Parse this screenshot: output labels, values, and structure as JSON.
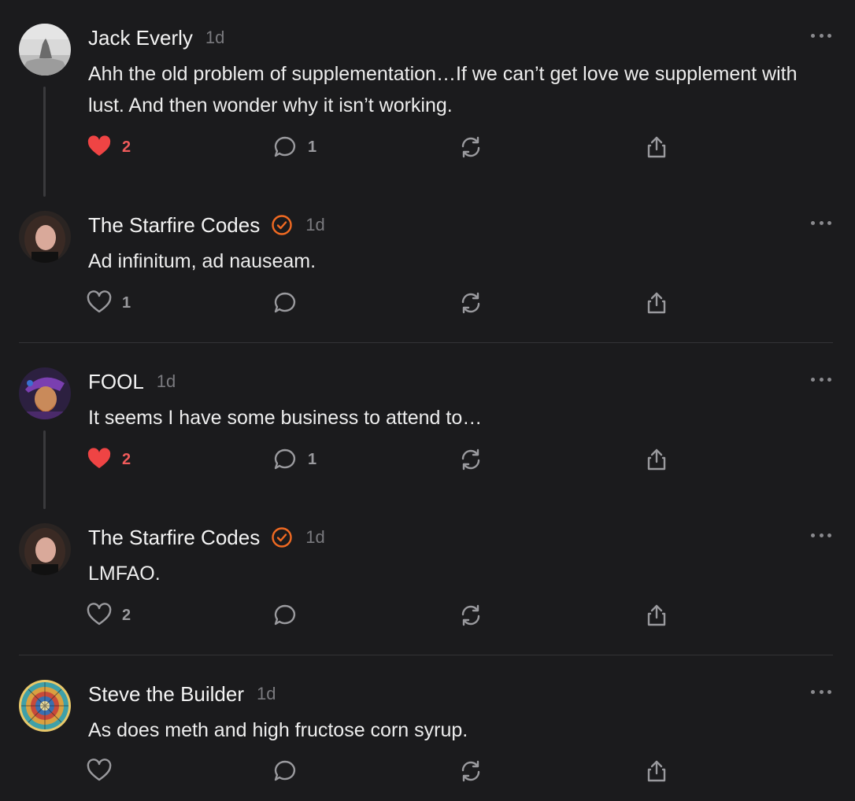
{
  "colors": {
    "background": "#1b1b1d",
    "liked": "#ef5a5a",
    "verified": "#f06a22",
    "muted": "#7a7a7e"
  },
  "comments": [
    {
      "author": "Jack Everly",
      "time": "1d",
      "verified": false,
      "text": "Ahh the old problem of supplementation…If we can’t get love we supplement with lust. And then wonder why it isn’t working.",
      "likes": "2",
      "liked": true,
      "replies": "1",
      "avatar": "misty-landscape-avatar"
    },
    {
      "author": "The Starfire Codes",
      "time": "1d",
      "verified": true,
      "text": "Ad infinitum, ad nauseam.",
      "likes": "1",
      "liked": false,
      "replies": "",
      "avatar": "woman-portrait-avatar"
    },
    {
      "author": "FOOL",
      "time": "1d",
      "verified": false,
      "text": "It seems I have some business to attend to…",
      "likes": "2",
      "liked": true,
      "replies": "1",
      "avatar": "jester-illustration-avatar"
    },
    {
      "author": "The Starfire Codes",
      "time": "1d",
      "verified": true,
      "text": "LMFAO.",
      "likes": "2",
      "liked": false,
      "replies": "",
      "avatar": "woman-portrait-avatar"
    },
    {
      "author": "Steve the Builder",
      "time": "1d",
      "verified": false,
      "text": "As does meth and high fructose corn syrup.",
      "likes": "",
      "liked": false,
      "replies": "",
      "avatar": "mandala-avatar"
    }
  ],
  "icons": {
    "like": "heart-icon",
    "reply": "speech-bubble-icon",
    "restack": "restack-icon",
    "share": "share-icon",
    "more": "more-options-icon",
    "verified": "verified-check-icon"
  }
}
